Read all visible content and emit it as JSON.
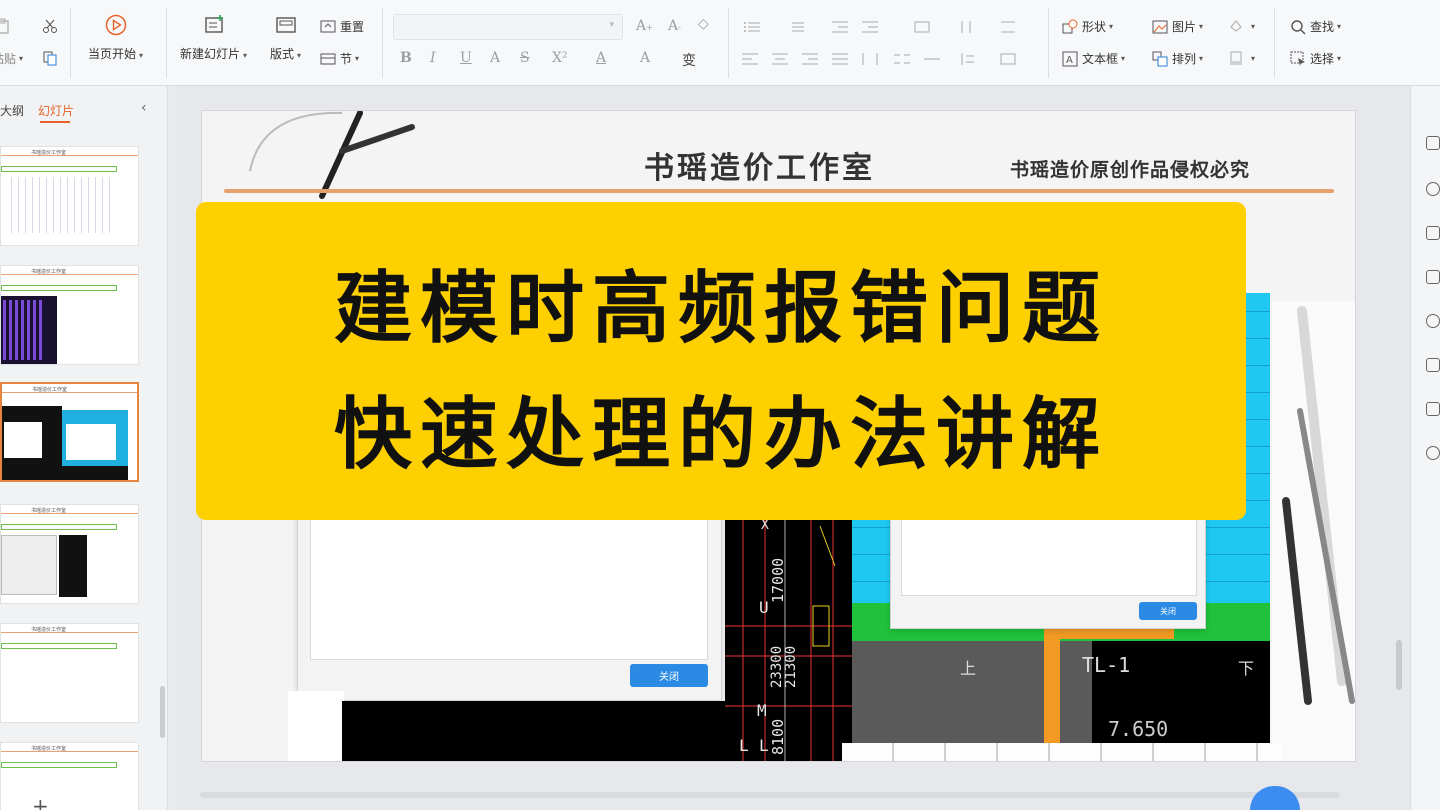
{
  "ribbon": {
    "paste_partial": "粘贴",
    "from_current": "当页开始",
    "new_slide": "新建幻灯片",
    "layout": "版式",
    "reset": "重置",
    "section": "节",
    "font_buttons": [
      "B",
      "I",
      "U",
      "A",
      "S",
      "X²",
      "A",
      "A",
      "变"
    ],
    "shapes": "形状",
    "picture": "图片",
    "textbox": "文本框",
    "arrange": "排列",
    "find": "查找",
    "select": "选择"
  },
  "left_panel": {
    "tab_outline": "大纲",
    "tab_slides": "幻灯片",
    "collapse_glyph": "‹",
    "add_glyph": "+",
    "thumb_title": "书瑶造价工作室",
    "active_index": 2
  },
  "slide": {
    "studio_title": "书瑶造价工作室",
    "copyright": "书瑶造价原创作品侵权必究",
    "close_button": "关闭",
    "cad_labels": {
      "x": "X",
      "u": "U",
      "m": "M",
      "l1": "L",
      "l2": "L",
      "dim1": "17000",
      "dim2": "23300",
      "dim3": "21300",
      "dim4": "8100",
      "elev": "7.650",
      "up": "上",
      "down": "下",
      "beam": "TL-1"
    }
  },
  "banner": {
    "line1": "建模时高频报错问题",
    "line2": "快速处理的办法讲解"
  },
  "colors": {
    "banner": "#fed000",
    "accent": "#e6642a",
    "close_button": "#2a8ae4"
  }
}
